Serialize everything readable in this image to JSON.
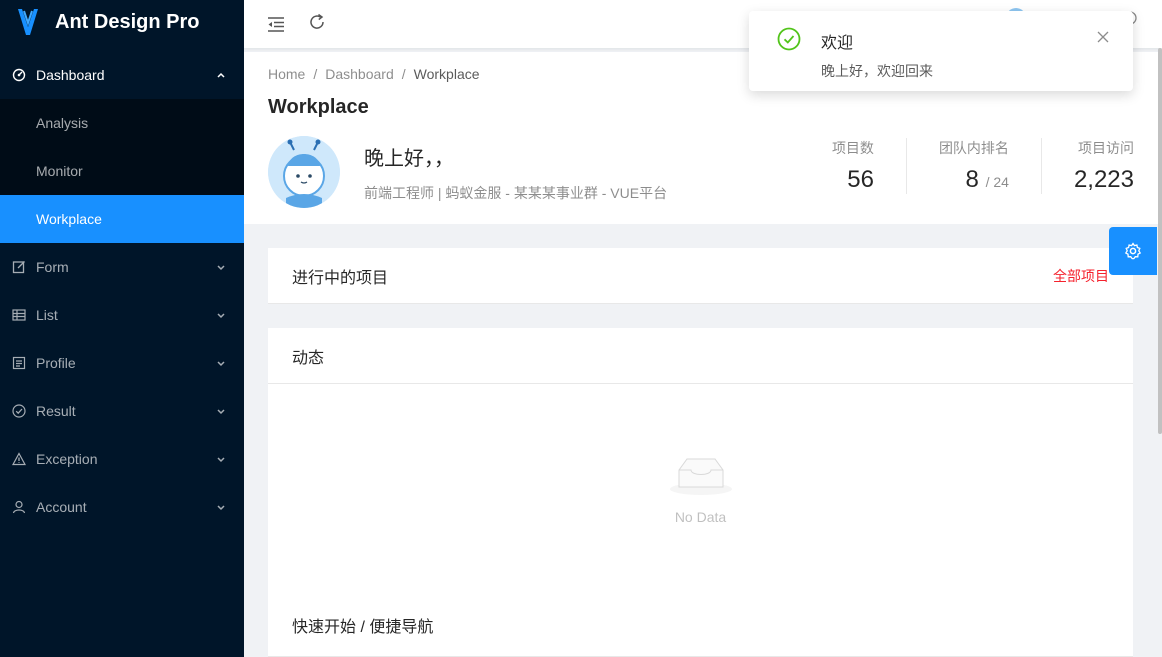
{
  "app": {
    "title": "Ant Design Pro"
  },
  "sidebar": {
    "items": [
      {
        "label": "Dashboard",
        "icon": "dashboard-icon"
      },
      {
        "label": "Form",
        "icon": "form-icon"
      },
      {
        "label": "List",
        "icon": "table-icon"
      },
      {
        "label": "Profile",
        "icon": "profile-icon"
      },
      {
        "label": "Result",
        "icon": "check-circle-icon"
      },
      {
        "label": "Exception",
        "icon": "warning-icon"
      },
      {
        "label": "Account",
        "icon": "user-icon"
      }
    ],
    "dashboard_children": [
      {
        "label": "Analysis"
      },
      {
        "label": "Monitor"
      },
      {
        "label": "Workplace"
      }
    ]
  },
  "breadcrumb": {
    "items": [
      "Home",
      "Dashboard",
      "Workplace"
    ],
    "separator": "/"
  },
  "page": {
    "title": "Workplace",
    "greeting": "晚上好，，",
    "subtitle": "前端工程师 | 蚂蚁金服 - 某某某事业群 - VUE平台"
  },
  "stats": [
    {
      "label": "项目数",
      "value": "56",
      "suffix": ""
    },
    {
      "label": "团队内排名",
      "value": "8",
      "suffix": "/ 24"
    },
    {
      "label": "项目访问",
      "value": "2,223",
      "suffix": ""
    }
  ],
  "projects_card": {
    "title": "进行中的项目",
    "extra": "全部项目"
  },
  "activity_card": {
    "title": "动态",
    "empty_text": "No Data"
  },
  "quick_card": {
    "title": "快速开始 / 便捷导航"
  },
  "notification": {
    "title": "欢迎",
    "description": "晚上好，欢迎回来"
  },
  "colors": {
    "primary": "#1890ff",
    "sider": "#001529",
    "success": "#52c41a",
    "extra_link": "#f5222d"
  }
}
